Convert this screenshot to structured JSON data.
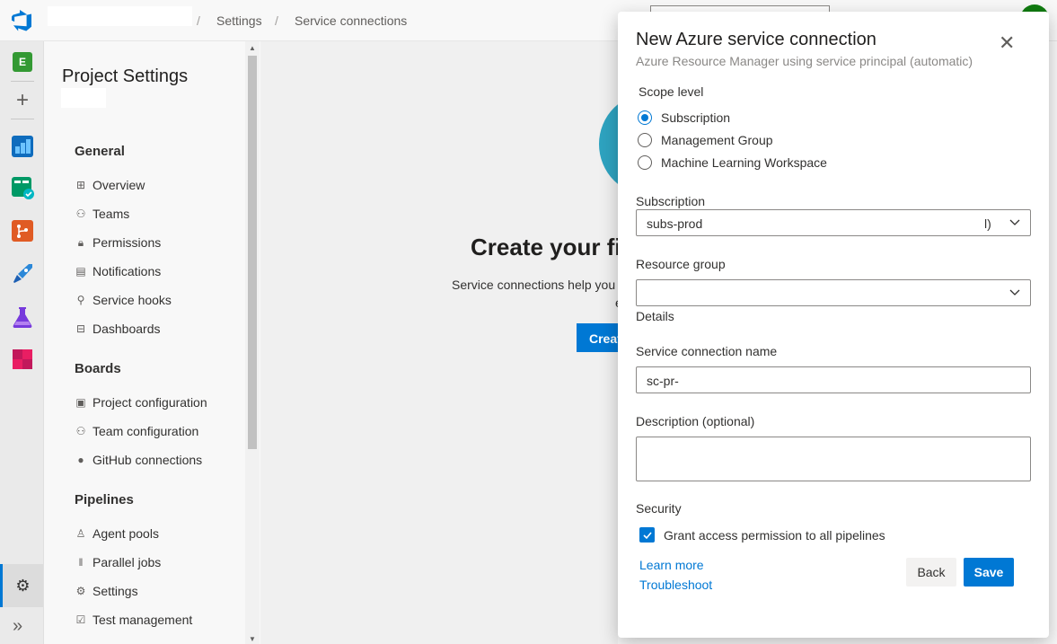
{
  "breadcrumb": {
    "settings": "Settings",
    "service_connections": "Service connections",
    "separator": "/"
  },
  "rail": {
    "project_initial": "E"
  },
  "settings_panel": {
    "title": "Project Settings",
    "sections": [
      {
        "heading": "General",
        "items": [
          "Overview",
          "Teams",
          "Permissions",
          "Notifications",
          "Service hooks",
          "Dashboards"
        ]
      },
      {
        "heading": "Boards",
        "items": [
          "Project configuration",
          "Team configuration",
          "GitHub connections"
        ]
      },
      {
        "heading": "Pipelines",
        "items": [
          "Agent pools",
          "Parallel jobs",
          "Settings",
          "Test management"
        ]
      }
    ]
  },
  "main": {
    "heading": "Create your fi",
    "subtext": "Service connections help you",
    "subtext2": "e",
    "button_label": "Creat"
  },
  "dialog": {
    "title": "New Azure service connection",
    "subtitle": "Azure Resource Manager using service principal (automatic)",
    "scope_label": "Scope level",
    "scope_options": [
      "Subscription",
      "Management Group",
      "Machine Learning Workspace"
    ],
    "scope_selected": "Subscription",
    "subscription_label": "Subscription",
    "subscription_value": "subs-prod",
    "subscription_suffix": "l)",
    "resource_group_label": "Resource group",
    "resource_group_value": "",
    "details_label": "Details",
    "connection_name_label": "Service connection name",
    "connection_name_value": "sc-pr-",
    "description_label": "Description (optional)",
    "description_value": "",
    "security_label": "Security",
    "grant_access_label": "Grant access permission to all pipelines",
    "grant_access_checked": true,
    "learn_more": "Learn more",
    "troubleshoot": "Troubleshoot",
    "back_label": "Back",
    "save_label": "Save"
  },
  "colors": {
    "accent": "#0078d4",
    "project_badge": "#339933"
  }
}
